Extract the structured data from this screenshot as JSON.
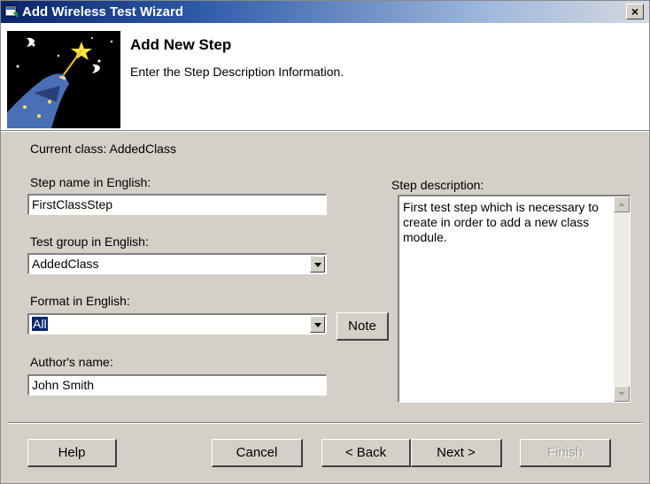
{
  "window": {
    "title": "Add Wireless Test Wizard",
    "close_glyph": "×"
  },
  "header": {
    "title": "Add New Step",
    "subtitle": "Enter the Step Description Information.",
    "illustration": "wizard-icon"
  },
  "form": {
    "current_class": "Current class: AddedClass",
    "step_name": {
      "label": "Step name in English:",
      "value": "FirstClassStep"
    },
    "test_group": {
      "label": "Test group in English:",
      "value": "AddedClass"
    },
    "format": {
      "label": "Format in English:",
      "value": "All"
    },
    "author": {
      "label": "Author's name:",
      "value": "John Smith"
    },
    "note_button": "Note",
    "step_description": {
      "label": "Step description:",
      "value": "First test step which is necessary to create in order to add a new class module."
    }
  },
  "buttons": {
    "help": "Help",
    "cancel": "Cancel",
    "back": "< Back",
    "next": "Next >",
    "finish": "Finish"
  },
  "colors": {
    "title_bar": "#0a246a",
    "dialog_bg": "#d4d0c8",
    "selection": "#0a246a"
  }
}
